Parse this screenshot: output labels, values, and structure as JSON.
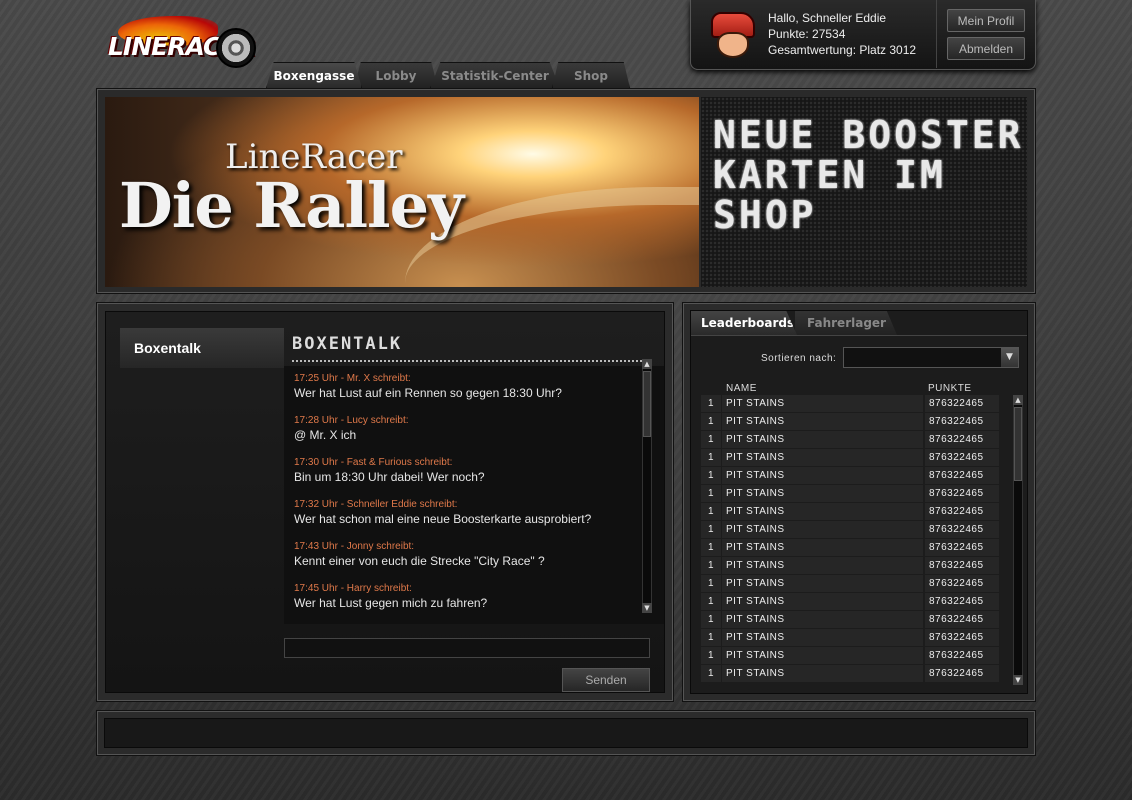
{
  "logo": {
    "text": "LINERACER"
  },
  "nav": {
    "tabs": [
      {
        "label": "Boxengasse",
        "active": true
      },
      {
        "label": "Lobby",
        "active": false
      },
      {
        "label": "Statistik-Center",
        "active": false
      },
      {
        "label": "Shop",
        "active": false
      }
    ]
  },
  "user": {
    "greeting": "Hallo, Schneller Eddie",
    "points": "Punkte: 27534",
    "ranking": "Gesamtwertung: Platz 3012",
    "profile_button": "Mein Profil",
    "logout_button": "Abmelden"
  },
  "banner": {
    "subtitle": "LineRacer",
    "title": "Die Ralley",
    "led_line1": "NEUE BOOSTER",
    "led_line2": "KARTEN IM SHOP"
  },
  "chat": {
    "side_tab": "Boxentalk",
    "heading": "BOXENTALK",
    "messages": [
      {
        "meta": "17:25 Uhr - Mr. X schreibt:",
        "text": "Wer hat Lust auf ein Rennen so gegen 18:30 Uhr?"
      },
      {
        "meta": "17:28 Uhr - Lucy schreibt:",
        "text": "@ Mr. X ich"
      },
      {
        "meta": "17:30 Uhr - Fast & Furious schreibt:",
        "text": "Bin um 18:30 Uhr dabei! Wer noch?"
      },
      {
        "meta": "17:32 Uhr - Schneller Eddie schreibt:",
        "text": "Wer hat schon mal eine neue Boosterkarte ausprobiert?"
      },
      {
        "meta": "17:43 Uhr - Jonny schreibt:",
        "text": "Kennt einer von euch die Strecke \"City Race\" ?"
      },
      {
        "meta": "17:45 Uhr - Harry schreibt:",
        "text": "Wer hat Lust gegen mich zu fahren?"
      }
    ],
    "input_value": "",
    "send_button": "Senden"
  },
  "leaderboard": {
    "tabs": [
      {
        "label": "Leaderboards",
        "active": true
      },
      {
        "label": "Fahrerlager",
        "active": false
      }
    ],
    "sort_label": "Sortieren nach:",
    "sort_value": "",
    "columns": {
      "name": "NAME",
      "points": "PUNKTE"
    },
    "rows": [
      {
        "rank": "1",
        "name": "PIT STAINS",
        "points": "876322465"
      },
      {
        "rank": "1",
        "name": "PIT STAINS",
        "points": "876322465"
      },
      {
        "rank": "1",
        "name": "PIT STAINS",
        "points": "876322465"
      },
      {
        "rank": "1",
        "name": "PIT STAINS",
        "points": "876322465"
      },
      {
        "rank": "1",
        "name": "PIT STAINS",
        "points": "876322465"
      },
      {
        "rank": "1",
        "name": "PIT STAINS",
        "points": "876322465"
      },
      {
        "rank": "1",
        "name": "PIT STAINS",
        "points": "876322465"
      },
      {
        "rank": "1",
        "name": "PIT STAINS",
        "points": "876322465"
      },
      {
        "rank": "1",
        "name": "PIT STAINS",
        "points": "876322465"
      },
      {
        "rank": "1",
        "name": "PIT STAINS",
        "points": "876322465"
      },
      {
        "rank": "1",
        "name": "PIT STAINS",
        "points": "876322465"
      },
      {
        "rank": "1",
        "name": "PIT STAINS",
        "points": "876322465"
      },
      {
        "rank": "1",
        "name": "PIT STAINS",
        "points": "876322465"
      },
      {
        "rank": "1",
        "name": "PIT STAINS",
        "points": "876322465"
      },
      {
        "rank": "1",
        "name": "PIT STAINS",
        "points": "876322465"
      },
      {
        "rank": "1",
        "name": "PIT STAINS",
        "points": "876322465"
      }
    ]
  },
  "icons": {
    "scroll_up": "up-arrow-icon",
    "scroll_down": "down-arrow-icon",
    "dropdown": "chevron-down-icon"
  }
}
